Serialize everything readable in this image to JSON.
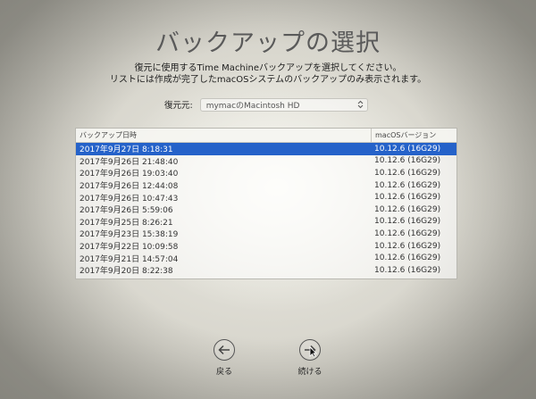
{
  "title": "バックアップの選択",
  "subtitle_line1": "復元に使用するTime Machineバックアップを選択してください。",
  "subtitle_line2": "リストには作成が完了したmacOSシステムのバックアップのみ表示されます。",
  "source": {
    "label": "復元元:",
    "value": "mymacのMacintosh HD"
  },
  "table": {
    "headers": [
      "バックアップ日時",
      "macOSバージョン"
    ],
    "rows": [
      {
        "date": "2017年9月27日 8:18:31",
        "version": "10.12.6 (16G29)",
        "selected": true
      },
      {
        "date": "2017年9月26日 21:48:40",
        "version": "10.12.6 (16G29)"
      },
      {
        "date": "2017年9月26日 19:03:40",
        "version": "10.12.6 (16G29)"
      },
      {
        "date": "2017年9月26日 12:44:08",
        "version": "10.12.6 (16G29)"
      },
      {
        "date": "2017年9月26日 10:47:43",
        "version": "10.12.6 (16G29)"
      },
      {
        "date": "2017年9月26日 5:59:06",
        "version": "10.12.6 (16G29)"
      },
      {
        "date": "2017年9月25日 8:26:21",
        "version": "10.12.6 (16G29)"
      },
      {
        "date": "2017年9月23日 15:38:19",
        "version": "10.12.6 (16G29)"
      },
      {
        "date": "2017年9月22日 10:09:58",
        "version": "10.12.6 (16G29)"
      },
      {
        "date": "2017年9月21日 14:57:04",
        "version": "10.12.6 (16G29)"
      },
      {
        "date": "2017年9月20日 8:22:38",
        "version": "10.12.6 (16G29)"
      }
    ]
  },
  "nav": {
    "back_label": "戻る",
    "next_label": "続ける"
  },
  "colors": {
    "selection": "#2562c9"
  }
}
